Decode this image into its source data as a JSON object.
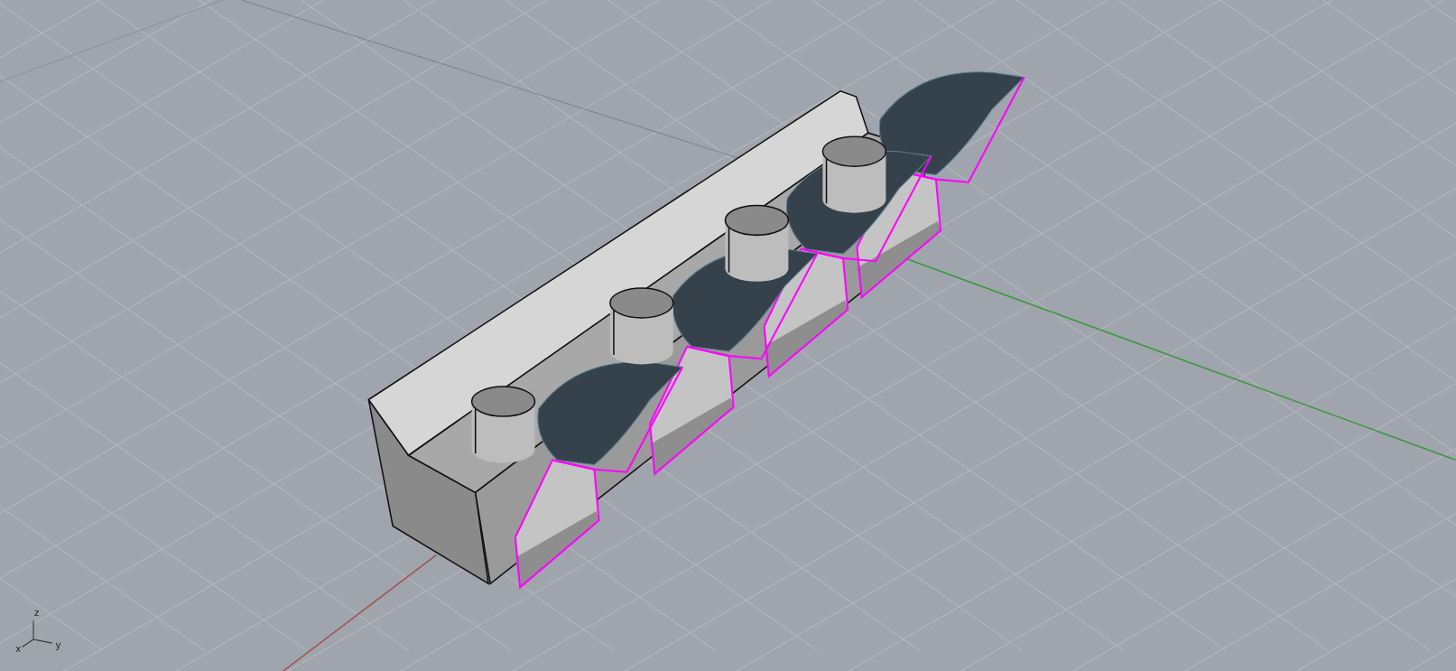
{
  "viewport": {
    "axis_labels": [
      "z",
      "x",
      "y"
    ]
  }
}
